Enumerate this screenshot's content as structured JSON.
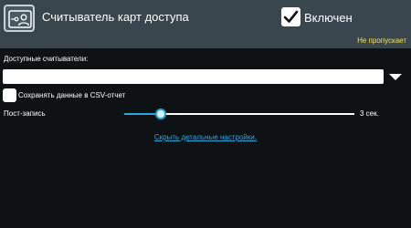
{
  "header": {
    "icon": "card-reader-icon",
    "title": "Считыватель карт доступа",
    "enabled": true,
    "enabled_label": "Включен",
    "status": "Не пропускает",
    "status_color": "#f2e25a"
  },
  "readers": {
    "label": "Доступные считыватели:",
    "selected": ""
  },
  "csv": {
    "checked": false,
    "label": "Сохранять данные в CSV-отчет"
  },
  "post_record": {
    "label": "Пост-запись",
    "level": 0.16,
    "value_text": "3 сек."
  },
  "details_link": "Скрыть детальные настройки.",
  "colors": {
    "accent": "#2aa7d6",
    "header_bg": "#3a464e",
    "background": "#0f1214"
  }
}
